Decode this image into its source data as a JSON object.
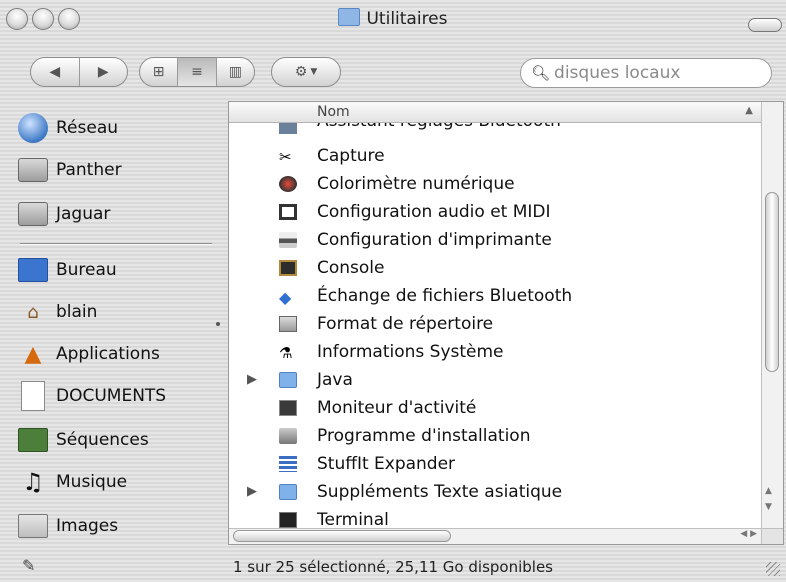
{
  "window": {
    "title": "Utilitaires",
    "controls": [
      "close",
      "minimize",
      "zoom"
    ]
  },
  "toolbar": {
    "back_icon": "back-arrow-icon",
    "forward_icon": "forward-arrow-icon",
    "view_modes": [
      "icon-view",
      "list-view",
      "column-view"
    ],
    "selected_view": "list-view",
    "action_icon": "gear-icon",
    "search": {
      "value": "disques locaux",
      "icon": "magnifier-icon"
    }
  },
  "sidebar": {
    "volumes": [
      {
        "label": "Réseau",
        "icon": "network-globe-icon"
      },
      {
        "label": "Panther",
        "icon": "hard-disk-icon"
      },
      {
        "label": "Jaguar",
        "icon": "hard-disk-icon"
      }
    ],
    "places": [
      {
        "label": "Bureau",
        "icon": "desktop-icon"
      },
      {
        "label": "blain",
        "icon": "home-icon"
      },
      {
        "label": "Applications",
        "icon": "applications-icon"
      },
      {
        "label": "DOCUMENTS",
        "icon": "document-icon"
      },
      {
        "label": "Séquences",
        "icon": "clapper-icon"
      },
      {
        "label": "Musique",
        "icon": "music-note-icon"
      },
      {
        "label": "Images",
        "icon": "pictures-icon"
      }
    ]
  },
  "list": {
    "column_header": "Nom",
    "sort_indicator": "ascending",
    "rows": [
      {
        "name": "Assistant réglages Bluetooth",
        "icon": "bluetooth-assistant-icon",
        "folder": false,
        "clipped": true
      },
      {
        "name": "Capture",
        "icon": "scissors-icon",
        "folder": false
      },
      {
        "name": "Colorimètre numérique",
        "icon": "color-meter-icon",
        "folder": false
      },
      {
        "name": "Configuration audio et MIDI",
        "icon": "midi-keyboard-icon",
        "folder": false
      },
      {
        "name": "Configuration d'imprimante",
        "icon": "printer-icon",
        "folder": false
      },
      {
        "name": "Console",
        "icon": "console-icon",
        "folder": false
      },
      {
        "name": "Échange de fichiers Bluetooth",
        "icon": "bluetooth-icon",
        "folder": false
      },
      {
        "name": "Format de répertoire",
        "icon": "directory-icon",
        "folder": false
      },
      {
        "name": "Informations Système",
        "icon": "system-info-icon",
        "folder": false
      },
      {
        "name": "Java",
        "icon": "folder-icon",
        "folder": true
      },
      {
        "name": "Moniteur d'activité",
        "icon": "activity-monitor-icon",
        "folder": false
      },
      {
        "name": "Programme d'installation",
        "icon": "installer-icon",
        "folder": false
      },
      {
        "name": "StuffIt Expander",
        "icon": "stuffit-icon",
        "folder": false
      },
      {
        "name": "Suppléments Texte asiatique",
        "icon": "folder-icon",
        "folder": true
      },
      {
        "name": "Terminal",
        "icon": "terminal-icon",
        "folder": false
      }
    ]
  },
  "status_bar": {
    "text": "1 sur 25 sélectionné, 25,11 Go disponibles",
    "left_icon": "write-disabled-icon"
  },
  "colors": {
    "folder_blue": "#7fb2e8",
    "search_placeholder": "#8a8a8a"
  }
}
